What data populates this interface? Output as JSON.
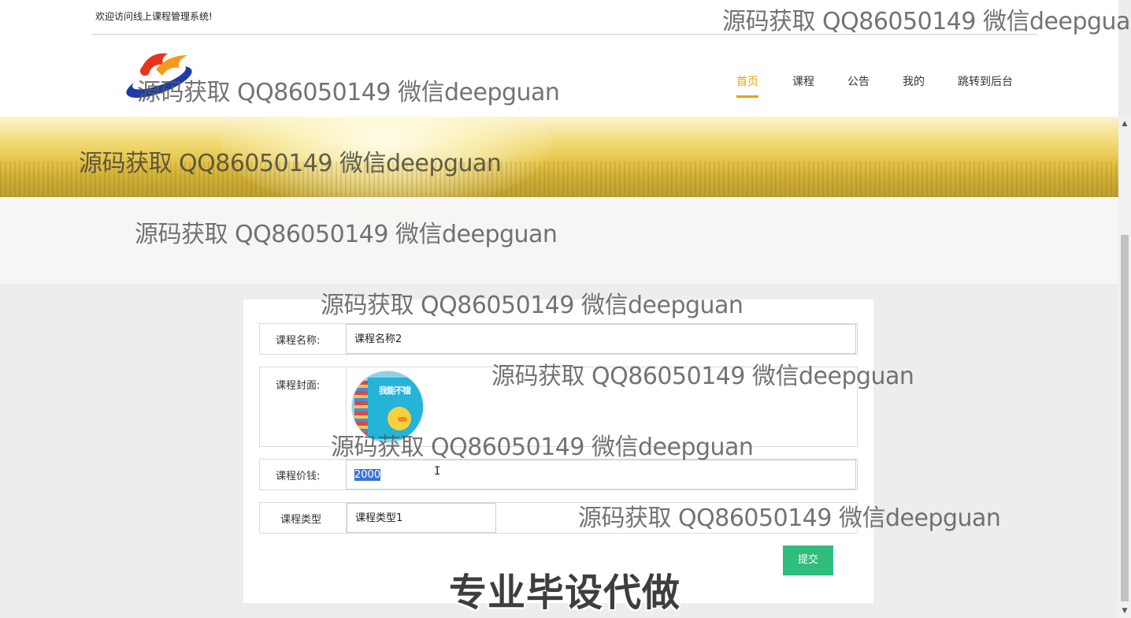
{
  "header": {
    "welcome": "欢迎访问线上课程管理系统!",
    "nav": [
      "首页",
      "课程",
      "公告",
      "我的",
      "跳转到后台"
    ]
  },
  "form": {
    "name_label": "课程名称:",
    "name_value": "课程名称2",
    "cover_label": "课程封面:",
    "cover_book_title": "我能不错",
    "price_label": "课程价钱:",
    "price_value": "2000",
    "type_label": "课程类型",
    "type_value": "课程类型1",
    "submit_label": "提交"
  },
  "watermarks": {
    "text": "源码获取 QQ86050149 微信deepguan",
    "top_right": "源码获取 QQ86050149 微信deepgua",
    "promo": "专业毕设代做"
  },
  "colors": {
    "accent": "#e5a300",
    "submit": "#2fbd7e",
    "selection": "#3874d8"
  }
}
